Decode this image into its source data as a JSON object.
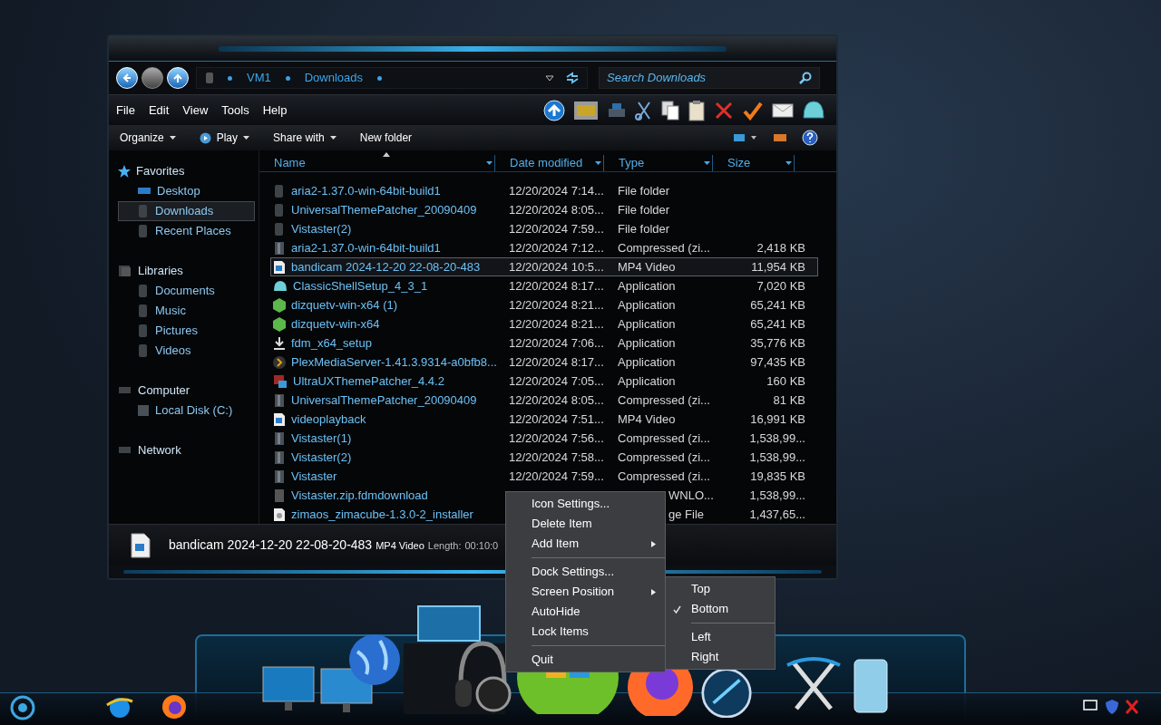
{
  "address_bar": {
    "path": [
      "VM1",
      "Downloads"
    ],
    "search_placeholder": "Search Downloads"
  },
  "menu_bar": [
    "File",
    "Edit",
    "View",
    "Tools",
    "Help"
  ],
  "command_bar": [
    {
      "label": "Organize",
      "dropdown": true,
      "kind": "text"
    },
    {
      "label": "Play",
      "dropdown": true,
      "kind": "play"
    },
    {
      "label": "Share with",
      "dropdown": true,
      "kind": "text"
    },
    {
      "label": "New folder",
      "dropdown": false,
      "kind": "text"
    }
  ],
  "sidebar": [
    {
      "label": "Favorites",
      "kind": "star",
      "children": [
        {
          "label": "Desktop",
          "kind": "desktop",
          "selected": false
        },
        {
          "label": "Downloads",
          "kind": "folder",
          "selected": true
        },
        {
          "label": "Recent Places",
          "kind": "folder",
          "selected": false
        }
      ]
    },
    {
      "label": "Libraries",
      "kind": "library",
      "children": [
        {
          "label": "Documents",
          "kind": "folder",
          "selected": false
        },
        {
          "label": "Music",
          "kind": "folder",
          "selected": false
        },
        {
          "label": "Pictures",
          "kind": "folder",
          "selected": false
        },
        {
          "label": "Videos",
          "kind": "folder",
          "selected": false
        }
      ]
    },
    {
      "label": "Computer",
      "kind": "computer",
      "children": [
        {
          "label": "Local Disk (C:)",
          "kind": "disk",
          "selected": false
        }
      ]
    },
    {
      "label": "Network",
      "kind": "computer"
    }
  ],
  "table": {
    "columns": [
      "Name",
      "Date modified",
      "Type",
      "Size"
    ],
    "rows": [
      {
        "name": "aria2-1.37.0-win-64bit-build1",
        "date": "12/20/2024 7:14...",
        "type": "File folder",
        "kind": "folder",
        "selected": false
      },
      {
        "name": "UniversalThemePatcher_20090409",
        "date": "12/20/2024 8:05...",
        "type": "File folder",
        "kind": "folder",
        "selected": false
      },
      {
        "name": "Vistaster(2)",
        "date": "12/20/2024 7:59...",
        "type": "File folder",
        "kind": "folder",
        "selected": false
      },
      {
        "name": "aria2-1.37.0-win-64bit-build1",
        "date": "12/20/2024 7:12...",
        "type": "Compressed (zi...",
        "size": "2,418 KB",
        "kind": "archive",
        "selected": false
      },
      {
        "name": "bandicam 2024-12-20 22-08-20-483",
        "date": "12/20/2024 10:5...",
        "type": "MP4 Video",
        "size": "11,954 KB",
        "kind": "video",
        "selected": true
      },
      {
        "name": "ClassicShellSetup_4_3_1",
        "date": "12/20/2024 8:17...",
        "type": "Application",
        "size": "7,020 KB",
        "kind": "shell",
        "selected": false
      },
      {
        "name": "dizquetv-win-x64 (1)",
        "date": "12/20/2024 8:21...",
        "type": "Application",
        "size": "65,241 KB",
        "kind": "package",
        "selected": false
      },
      {
        "name": "dizquetv-win-x64",
        "date": "12/20/2024 8:21...",
        "type": "Application",
        "size": "65,241 KB",
        "kind": "package",
        "selected": false
      },
      {
        "name": "fdm_x64_setup",
        "date": "12/20/2024 7:06...",
        "type": "Application",
        "size": "35,776 KB",
        "kind": "download",
        "selected": false
      },
      {
        "name": "PlexMediaServer-1.41.3.9314-a0bfb8...",
        "date": "12/20/2024 8:17...",
        "type": "Application",
        "size": "97,435 KB",
        "kind": "chevron",
        "selected": false
      },
      {
        "name": "UltraUXThemePatcher_4.4.2",
        "date": "12/20/2024 7:05...",
        "type": "Application",
        "size": "160 KB",
        "kind": "patcher",
        "selected": false
      },
      {
        "name": "UniversalThemePatcher_20090409",
        "date": "12/20/2024 8:05...",
        "type": "Compressed (zi...",
        "size": "81 KB",
        "kind": "archive",
        "selected": false
      },
      {
        "name": "videoplayback",
        "date": "12/20/2024 7:51...",
        "type": "MP4 Video",
        "size": "16,991 KB",
        "kind": "video",
        "selected": false
      },
      {
        "name": "Vistaster(1)",
        "date": "12/20/2024 7:56...",
        "type": "Compressed (zi...",
        "size": "1,538,99...",
        "kind": "archive",
        "selected": false
      },
      {
        "name": "Vistaster(2)",
        "date": "12/20/2024 7:58...",
        "type": "Compressed (zi...",
        "size": "1,538,99...",
        "kind": "archive",
        "selected": false
      },
      {
        "name": "Vistaster",
        "date": "12/20/2024 7:59...",
        "type": "Compressed (zi...",
        "size": "19,835 KB",
        "kind": "archive",
        "selected": false
      },
      {
        "name": "Vistaster.zip.fdmdownload",
        "type": "WNLO...",
        "size": "1,538,99...",
        "kind": "partial",
        "selected": false,
        "covered": true
      },
      {
        "name": "zimaos_zimacube-1.3.0-2_installer",
        "type": "ge File",
        "size": "1,437,65...",
        "kind": "disc",
        "selected": false,
        "covered": true
      }
    ]
  },
  "details_pane": {
    "name": "bandicam 2024-12-20 22-08-20-483",
    "type": "MP4 Video",
    "length_label": "Length:",
    "length": "00:10:0"
  },
  "context_menu": [
    {
      "label": "Icon Settings...",
      "kind": "item"
    },
    {
      "label": "Delete Item",
      "kind": "item"
    },
    {
      "label": "Add Item",
      "kind": "submenu"
    },
    {
      "kind": "separator"
    },
    {
      "label": "Dock Settings...",
      "kind": "item"
    },
    {
      "label": "Screen Position",
      "kind": "submenu"
    },
    {
      "label": "AutoHide",
      "kind": "item"
    },
    {
      "label": "Lock Items",
      "kind": "item"
    },
    {
      "kind": "separator"
    },
    {
      "label": "Quit",
      "kind": "item"
    }
  ],
  "submenu": [
    {
      "label": "Top",
      "kind": "item",
      "checked": false
    },
    {
      "label": "Bottom",
      "kind": "item",
      "checked": true
    },
    {
      "kind": "separator"
    },
    {
      "label": "Left",
      "kind": "item",
      "checked": false
    },
    {
      "label": "Right",
      "kind": "item",
      "checked": false
    }
  ]
}
